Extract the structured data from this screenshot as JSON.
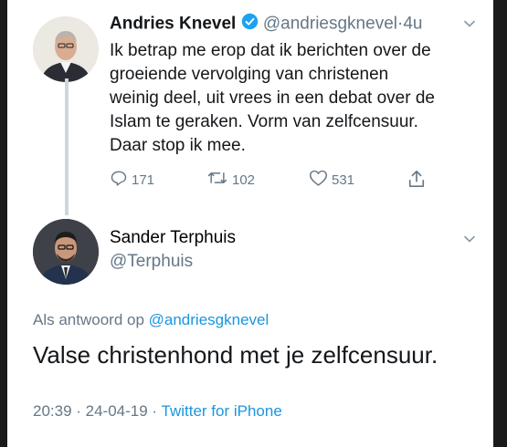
{
  "tweet": {
    "author_name": "Andries Knevel",
    "handle": "@andriesgknevel",
    "separator": "·",
    "time_ago": "4u",
    "lines": [
      "Ik betrap me erop dat ik berichten over de",
      "groeiende vervolging van christenen",
      "weinig deel, uit vrees in een debat over de",
      "Islam te geraken. Vorm van zelfcensuur.",
      "Daar stop ik mee."
    ],
    "replies": "171",
    "retweets": "102",
    "likes": "531",
    "icons": [
      "reply-icon",
      "retweet-icon",
      "like-icon",
      "share-icon",
      "verified-icon",
      "chevron-down-icon"
    ]
  },
  "reply": {
    "author_name": "Sander Terphuis",
    "handle": "@Terphuis",
    "in_reply_prefix": "Als antwoord op",
    "in_reply_handle": "@andriesgknevel",
    "text": "Valse christenhond met je zelfcensuur.",
    "timestamp": "20:39 · 24-04-19 ·",
    "source": "Twitter for iPhone"
  },
  "colors": {
    "link": "#1b95e0",
    "muted": "#657786",
    "text": "#14171a",
    "verified": "#1da1f2"
  }
}
